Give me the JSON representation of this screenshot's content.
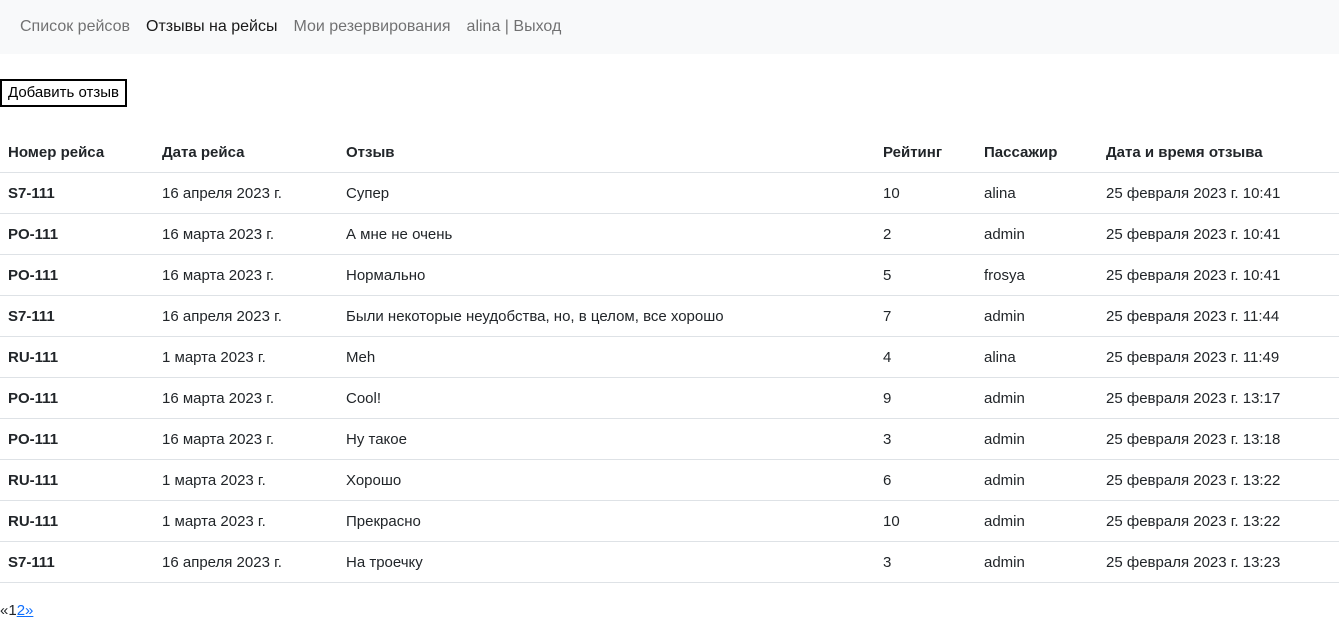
{
  "nav": {
    "items": [
      {
        "label": "Список рейсов",
        "active": false
      },
      {
        "label": "Отзывы на рейсы",
        "active": true
      },
      {
        "label": "Мои резервирования",
        "active": false
      }
    ],
    "user": "alina",
    "separator": " | ",
    "logout": "Выход"
  },
  "add_button": "Добавить отзыв",
  "table": {
    "headers": [
      "Номер рейса",
      "Дата рейса",
      "Отзыв",
      "Рейтинг",
      "Пассажир",
      "Дата и время отзыва"
    ],
    "rows": [
      [
        "S7-111",
        "16 апреля 2023 г.",
        "Супер",
        "10",
        "alina",
        "25 февраля 2023 г. 10:41"
      ],
      [
        "PO-111",
        "16 марта 2023 г.",
        "А мне не очень",
        "2",
        "admin",
        "25 февраля 2023 г. 10:41"
      ],
      [
        "PO-111",
        "16 марта 2023 г.",
        "Нормально",
        "5",
        "frosya",
        "25 февраля 2023 г. 10:41"
      ],
      [
        "S7-111",
        "16 апреля 2023 г.",
        "Были некоторые неудобства, но, в целом, все хорошо",
        "7",
        "admin",
        "25 февраля 2023 г. 11:44"
      ],
      [
        "RU-111",
        "1 марта 2023 г.",
        "Meh",
        "4",
        "alina",
        "25 февраля 2023 г. 11:49"
      ],
      [
        "PO-111",
        "16 марта 2023 г.",
        "Cool!",
        "9",
        "admin",
        "25 февраля 2023 г. 13:17"
      ],
      [
        "PO-111",
        "16 марта 2023 г.",
        "Ну такое",
        "3",
        "admin",
        "25 февраля 2023 г. 13:18"
      ],
      [
        "RU-111",
        "1 марта 2023 г.",
        "Хорошо",
        "6",
        "admin",
        "25 февраля 2023 г. 13:22"
      ],
      [
        "RU-111",
        "1 марта 2023 г.",
        "Прекрасно",
        "10",
        "admin",
        "25 февраля 2023 г. 13:22"
      ],
      [
        "S7-111",
        "16 апреля 2023 г.",
        "На троечку",
        "3",
        "admin",
        "25 февраля 2023 г. 13:23"
      ]
    ]
  },
  "pagination": {
    "prev": "«",
    "current": "1",
    "next_page": "2",
    "next": "»"
  }
}
